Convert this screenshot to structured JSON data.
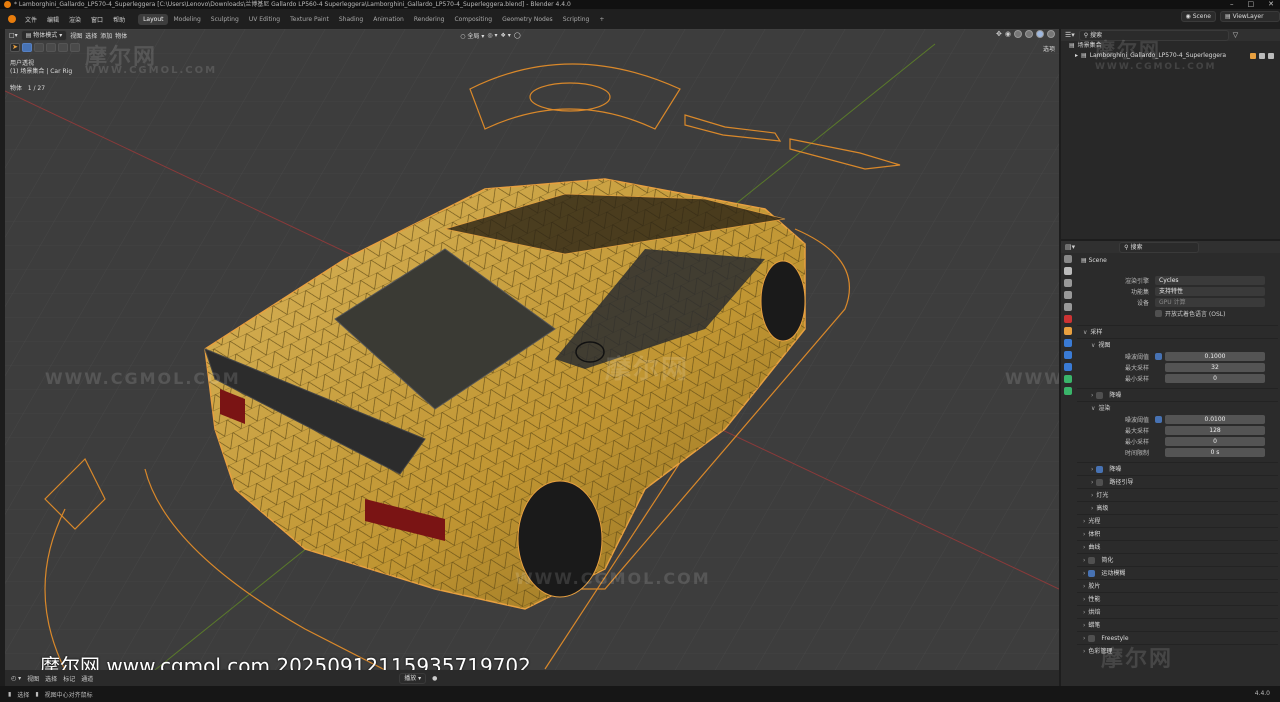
{
  "window": {
    "title": "* Lamborghini_Gallardo_LP570-4_Superleggera [C:\\Users\\Lenovo\\Downloads\\兰博基尼 Gallardo LP560-4 Superleggera\\Lamborghini_Gallardo_LP570-4_Superleggera.blend] - Blender 4.4.0"
  },
  "menu": {
    "items": [
      "文件",
      "编辑",
      "渲染",
      "窗口",
      "帮助"
    ],
    "workspaces": [
      "Layout",
      "Modeling",
      "Sculpting",
      "UV Editing",
      "Texture Paint",
      "Shading",
      "Animation",
      "Rendering",
      "Compositing",
      "Geometry Nodes",
      "Scripting"
    ],
    "active_workspace": "Layout",
    "add_tab": "+",
    "scene": "Scene",
    "view_layer": "ViewLayer"
  },
  "viewport": {
    "mode": "物体模式",
    "menus": [
      "视图",
      "选择",
      "添加",
      "物体"
    ],
    "transform": "全局",
    "info_line1": "用户透视",
    "info_line2": "(1) 场景集合 | Car Rig",
    "object_label": "物体",
    "object_count": "1 / 27",
    "options": "选项"
  },
  "outliner": {
    "search_placeholder": "搜索",
    "root": "场景集合",
    "child": "Lamborghini_Gallardo_LP570-4_Superleggera"
  },
  "properties": {
    "search_placeholder": "搜索",
    "scene_name": "Scene",
    "render_engine_label": "渲染引擎",
    "render_engine": "Cycles",
    "feature_set_label": "功能集",
    "feature_set": "支持特性",
    "device_label": "设备",
    "device": "GPU 计算",
    "osl_label": "开放式着色语言 (OSL)",
    "sampling": "采样",
    "viewport_sub": "视图",
    "noise_threshold_label": "噪波阈值",
    "vp_noise_threshold": "0.1000",
    "max_samples_label": "最大采样",
    "vp_max_samples": "32",
    "min_samples_label": "最小采样",
    "vp_min_samples": "0",
    "denoise_label": "降噪",
    "render_sub": "渲染",
    "r_noise_threshold": "0.0100",
    "r_max_samples": "128",
    "r_min_samples": "0",
    "time_limit_label": "时间限制",
    "r_time_limit": "0 s",
    "denoise2_label": "降噪",
    "path_guiding_label": "路径引导",
    "lights_label": "灯光",
    "advanced_label": "高级",
    "sections": [
      "光程",
      "体积",
      "曲线",
      "简化",
      "运动模糊",
      "胶片",
      "性能",
      "烘焙",
      "蜡笔",
      "Freestyle",
      "色彩管理"
    ]
  },
  "bottom_bar": {
    "items": [
      "视图",
      "选择",
      "标记",
      "通道"
    ],
    "playback": "播放"
  },
  "status": {
    "select": "选择",
    "rotate": "视图中心对齐鼠标",
    "version": "4.4.0"
  },
  "watermark": {
    "logo": "摩尔网",
    "site": "WWW.CGMOL.COM",
    "caption": "摩尔网 www.cgmol.com 20250912115935719702"
  },
  "colors": {
    "accent": "#4772b3",
    "selection": "#e8a040",
    "viewport_bg": "#3d3d3d",
    "car_body": "#c9a23a"
  }
}
